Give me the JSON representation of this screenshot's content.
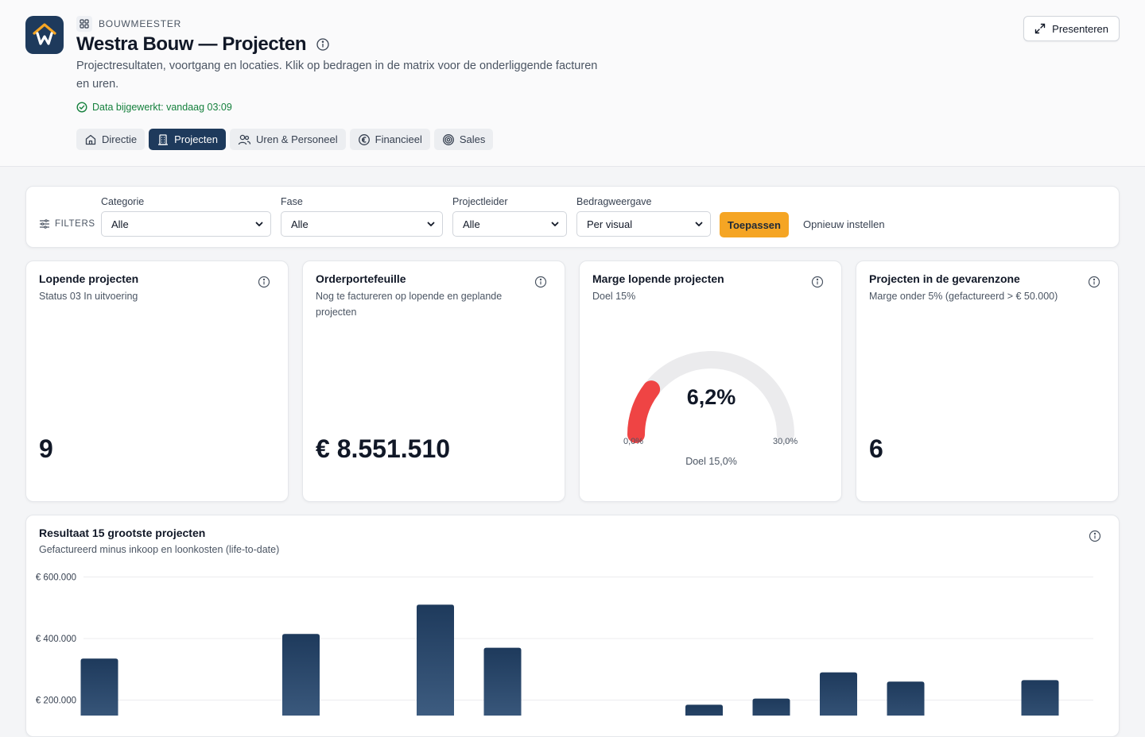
{
  "header": {
    "brand_label": "BOUWMEESTER",
    "title": "Westra Bouw — Projecten",
    "subtitle": "Projectresultaten, voortgang en locaties. Klik op bedragen in de matrix voor de onderliggende facturen en uren.",
    "updated": "Data bijgewerkt: vandaag 03:09",
    "present_label": "Presenteren"
  },
  "tabs": [
    {
      "label": "Directie",
      "icon": "home-icon",
      "active": false
    },
    {
      "label": "Projecten",
      "icon": "building-icon",
      "active": true
    },
    {
      "label": "Uren & Personeel",
      "icon": "users-icon",
      "active": false
    },
    {
      "label": "Financieel",
      "icon": "euro-icon",
      "active": false
    },
    {
      "label": "Sales",
      "icon": "target-icon",
      "active": false
    }
  ],
  "filters": {
    "label": "FILTERS",
    "categorie": {
      "label": "Categorie",
      "value": "Alle"
    },
    "fase": {
      "label": "Fase",
      "value": "Alle"
    },
    "projectleider": {
      "label": "Projectleider",
      "value": "Alle"
    },
    "bedragweergave": {
      "label": "Bedragweergave",
      "value": "Per visual"
    },
    "apply_label": "Toepassen",
    "reset_label": "Opnieuw instellen"
  },
  "kpis": {
    "lopende": {
      "title": "Lopende projecten",
      "subtitle": "Status 03 In uitvoering",
      "value": "9"
    },
    "orderportefeuille": {
      "title": "Orderportefeuille",
      "subtitle": "Nog te factureren op lopende en geplande projecten",
      "value": "€ 8.551.510"
    },
    "marge": {
      "title": "Marge lopende projecten",
      "subtitle": "Doel 15%",
      "value_label": "6,2%",
      "value": 6.2,
      "min": 0,
      "max": 30,
      "min_label": "0,0%",
      "max_label": "30,0%",
      "target_label": "Doel 15,0%",
      "color_value": "#ef4444",
      "color_track": "#ebebed"
    },
    "gevarenzone": {
      "title": "Projecten in de gevarenzone",
      "subtitle": "Marge onder 5% (gefactureerd > € 50.000)",
      "value": "6"
    }
  },
  "chart": {
    "title": "Resultaat 15 grootste projecten",
    "subtitle": "Gefactureerd minus inkoop en loonkosten (life-to-date)"
  },
  "chart_data": {
    "type": "bar",
    "title": "Resultaat 15 grootste projecten",
    "ylabel": "",
    "xlabel": "",
    "ylim": [
      0,
      600000
    ],
    "y_ticks": [
      200000,
      400000,
      600000
    ],
    "y_tick_labels": [
      "€ 200.000",
      "€ 400.000",
      "€ 600.000"
    ],
    "values": [
      335000,
      0,
      0,
      415000,
      0,
      510000,
      370000,
      0,
      0,
      185000,
      205000,
      290000,
      260000,
      0,
      265000
    ],
    "color": "#1e3a5c"
  }
}
